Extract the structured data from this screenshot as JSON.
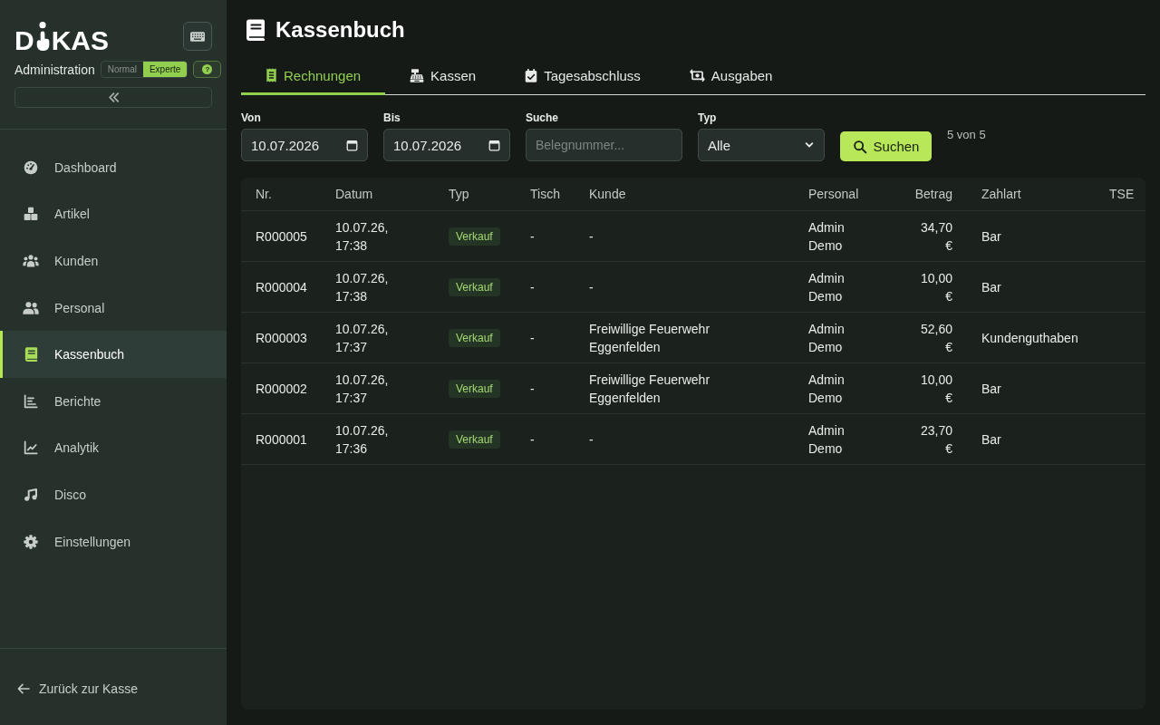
{
  "sidebar": {
    "logo": {
      "left": "D",
      "right": "KAS"
    },
    "subtitle": "Administration",
    "modes": [
      {
        "label": "Normal",
        "selected": false
      },
      {
        "label": "Experte",
        "selected": true
      }
    ],
    "help_button": "?",
    "nav": [
      {
        "label": "Dashboard",
        "selected": false
      },
      {
        "label": "Artikel",
        "selected": false
      },
      {
        "label": "Kunden",
        "selected": false
      },
      {
        "label": "Personal",
        "selected": false
      },
      {
        "label": "Kassenbuch",
        "selected": true
      },
      {
        "label": "Berichte",
        "selected": false
      },
      {
        "label": "Analytik",
        "selected": false
      },
      {
        "label": "Disco",
        "selected": false
      },
      {
        "label": "Einstellungen",
        "selected": false
      }
    ],
    "back_link": "Zurück zur Kasse"
  },
  "page": {
    "title": "Kassenbuch"
  },
  "tabs": [
    {
      "label": "Rechnungen",
      "selected": true
    },
    {
      "label": "Kassen",
      "selected": false
    },
    {
      "label": "Tagesabschluss",
      "selected": false
    },
    {
      "label": "Ausgaben",
      "selected": false
    }
  ],
  "filters": {
    "from": {
      "label": "Von",
      "value": "10.07.2026"
    },
    "to": {
      "label": "Bis",
      "value": "10.07.2026"
    },
    "search": {
      "label": "Suche",
      "placeholder": "Belegnummer..."
    },
    "type": {
      "label": "Typ",
      "value": "Alle"
    },
    "search_button": "Suchen",
    "count": "5 von 5"
  },
  "table": {
    "columns": [
      "Nr.",
      "Datum",
      "Typ",
      "Tisch",
      "Kunde",
      "Personal",
      "Betrag",
      "Zahlart",
      "TSE"
    ],
    "rows": [
      {
        "nr": "R000005",
        "datum": "10.07.26, 17:38",
        "typ": "Verkauf",
        "tisch": "-",
        "kunde": "-",
        "personal": "Admin Demo",
        "betrag": "34,70 €",
        "zahlart": "Bar"
      },
      {
        "nr": "R000004",
        "datum": "10.07.26, 17:38",
        "typ": "Verkauf",
        "tisch": "-",
        "kunde": "-",
        "personal": "Admin Demo",
        "betrag": "10,00 €",
        "zahlart": "Bar"
      },
      {
        "nr": "R000003",
        "datum": "10.07.26, 17:37",
        "typ": "Verkauf",
        "tisch": "-",
        "kunde": "Freiwillige Feuerwehr Eggenfelden",
        "personal": "Admin Demo",
        "betrag": "52,60 €",
        "zahlart": "Kundenguthaben"
      },
      {
        "nr": "R000002",
        "datum": "10.07.26, 17:37",
        "typ": "Verkauf",
        "tisch": "-",
        "kunde": "Freiwillige Feuerwehr Eggenfelden",
        "personal": "Admin Demo",
        "betrag": "10,00 €",
        "zahlart": "Bar"
      },
      {
        "nr": "R000001",
        "datum": "10.07.26, 17:36",
        "typ": "Verkauf",
        "tisch": "-",
        "kunde": "-",
        "personal": "Admin Demo",
        "betrag": "23,70 €",
        "zahlart": "Bar"
      }
    ]
  }
}
